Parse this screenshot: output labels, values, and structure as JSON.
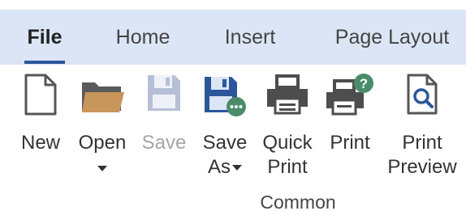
{
  "tabs": [
    {
      "label": "File",
      "active": true
    },
    {
      "label": "Home",
      "active": false
    },
    {
      "label": "Insert",
      "active": false
    },
    {
      "label": "Page Layout",
      "active": false
    }
  ],
  "commands": {
    "new": {
      "label": "New",
      "icon": "new-document-icon"
    },
    "open": {
      "label": "Open",
      "icon": "folder-icon",
      "dropdown": true
    },
    "save": {
      "label": "Save",
      "icon": "save-disk-icon",
      "disabled": true
    },
    "save_as": {
      "line1": "Save",
      "line2": "As",
      "icon": "save-as-icon",
      "dropdown": true
    },
    "quick_print": {
      "line1": "Quick",
      "line2": "Print",
      "icon": "printer-icon"
    },
    "print": {
      "label": "Print",
      "icon": "print-dialog-icon"
    },
    "print_preview": {
      "line1": "Print",
      "line2": "Preview",
      "icon": "print-preview-icon"
    }
  },
  "group": {
    "label": "Common"
  },
  "colors": {
    "tabbar_bg": "#dbe5f5",
    "accent": "#2b579a",
    "folder": "#c8955a",
    "disabled": "#a6a6a6",
    "save_as_badge": "#4a8c6a"
  }
}
